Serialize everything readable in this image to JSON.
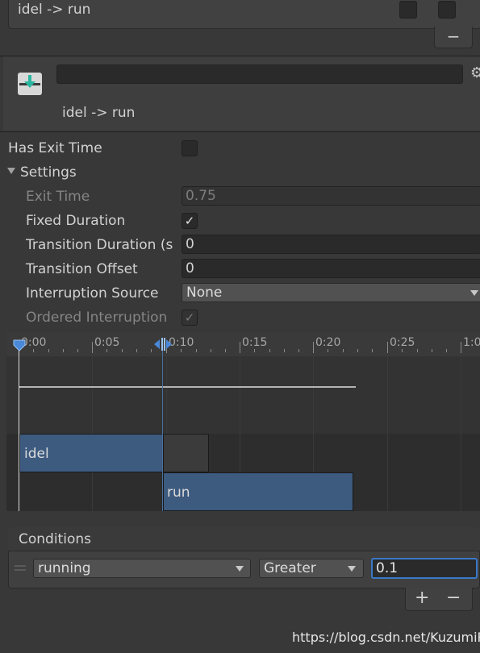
{
  "top": {
    "transition_label": "idel -> run",
    "remove_symbol": "−"
  },
  "header": {
    "name_value": "",
    "title": "idel -> run",
    "gear_symbol": "⚙"
  },
  "props": {
    "has_exit_time": {
      "label": "Has Exit Time",
      "checked": false
    },
    "settings_label": "Settings",
    "exit_time": {
      "label": "Exit Time",
      "value": "0.75"
    },
    "fixed_duration": {
      "label": "Fixed Duration",
      "checked": true
    },
    "transition_duration": {
      "label": "Transition Duration (s",
      "value": "0"
    },
    "transition_offset": {
      "label": "Transition Offset",
      "value": "0"
    },
    "interruption_source": {
      "label": "Interruption Source",
      "value": "None"
    },
    "ordered_interruption": {
      "label": "Ordered Interruption",
      "checked": true
    }
  },
  "timeline": {
    "ticks": [
      "0:00",
      "0:05",
      "0:10",
      "0:15",
      "0:20",
      "0:25",
      "1:0"
    ],
    "tracks": {
      "source": "idel",
      "destination": "run"
    }
  },
  "conditions": {
    "title": "Conditions",
    "row": {
      "parameter": "running",
      "mode": "Greater",
      "value": "0.1"
    },
    "add_symbol": "+",
    "remove_symbol": "−"
  },
  "watermark": "https://blog.csdn.net/KuzumiRin",
  "colors": {
    "background": "#383838",
    "track_blue": "#3d5a7f",
    "playhead": "#4a88d8"
  }
}
